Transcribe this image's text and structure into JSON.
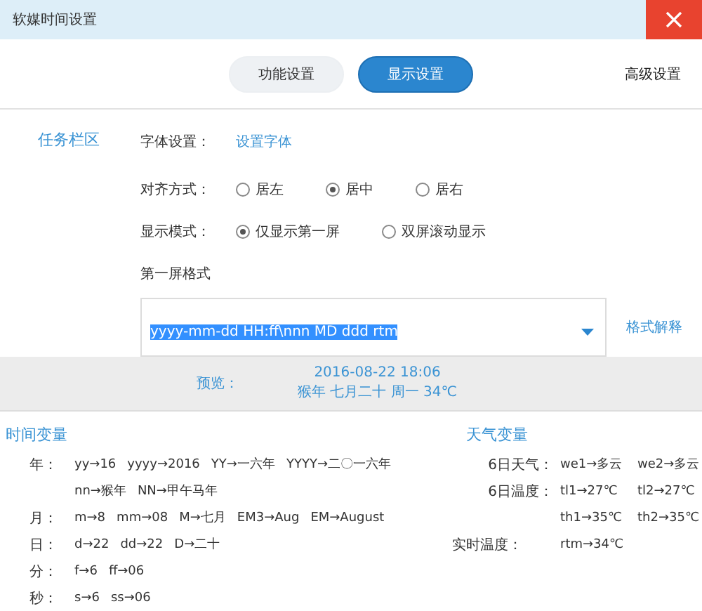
{
  "window": {
    "title": "软媒时间设置"
  },
  "tabs": [
    {
      "label": "功能设置",
      "selected": false
    },
    {
      "label": "显示设置",
      "selected": true
    }
  ],
  "advanced_link": "高级设置",
  "sidebar": {
    "label": "任务栏区"
  },
  "font_setting": {
    "label": "字体设置：",
    "link": "设置字体"
  },
  "align": {
    "label": "对齐方式：",
    "options": [
      {
        "label": "居左",
        "selected": false
      },
      {
        "label": "居中",
        "selected": true
      },
      {
        "label": "居右",
        "selected": false
      }
    ]
  },
  "display_mode": {
    "label": "显示模式：",
    "options": [
      {
        "label": "仅显示第一屏",
        "selected": true
      },
      {
        "label": "双屏滚动显示",
        "selected": false
      }
    ]
  },
  "format": {
    "label": "第一屏格式",
    "value": "yyyy-mm-dd HH:ff\\nnn MD ddd rtm",
    "help_link": "格式解释"
  },
  "preview": {
    "label": "预览：",
    "lines": [
      "2016-08-22 18:06",
      "猴年 七月二十 周一 34℃"
    ]
  },
  "time_vars": {
    "title": "时间变量",
    "rows": [
      {
        "label": "年：",
        "items": [
          "yy→16",
          "yyyy→2016",
          "YY→一六年",
          "YYYY→二〇一六年"
        ]
      },
      {
        "items": [
          "nn→猴年",
          "NN→甲午马年"
        ]
      },
      {
        "label": "月：",
        "items": [
          "m→8",
          "mm→08",
          "M→七月",
          "EM3→Aug",
          "EM→August"
        ]
      },
      {
        "label": "日：",
        "items": [
          "d→22",
          "dd→22",
          "D→二十"
        ]
      },
      {
        "label": "分：",
        "items": [
          "f→6",
          "ff→06"
        ]
      },
      {
        "label": "秒：",
        "items": [
          "s→6",
          "ss→06"
        ]
      }
    ]
  },
  "weather_vars": {
    "title": "天气变量",
    "rows": [
      {
        "label": "6日天气：",
        "items": [
          "we1→多云",
          "we2→多云"
        ]
      },
      {
        "label": "6日温度：",
        "items": [
          "tl1→27℃",
          "tl2→27℃"
        ]
      },
      {
        "items": [
          "th1→35℃",
          "th2→35℃"
        ]
      },
      {
        "label": "实时温度：",
        "items": [
          "rtm→34℃"
        ]
      }
    ]
  }
}
